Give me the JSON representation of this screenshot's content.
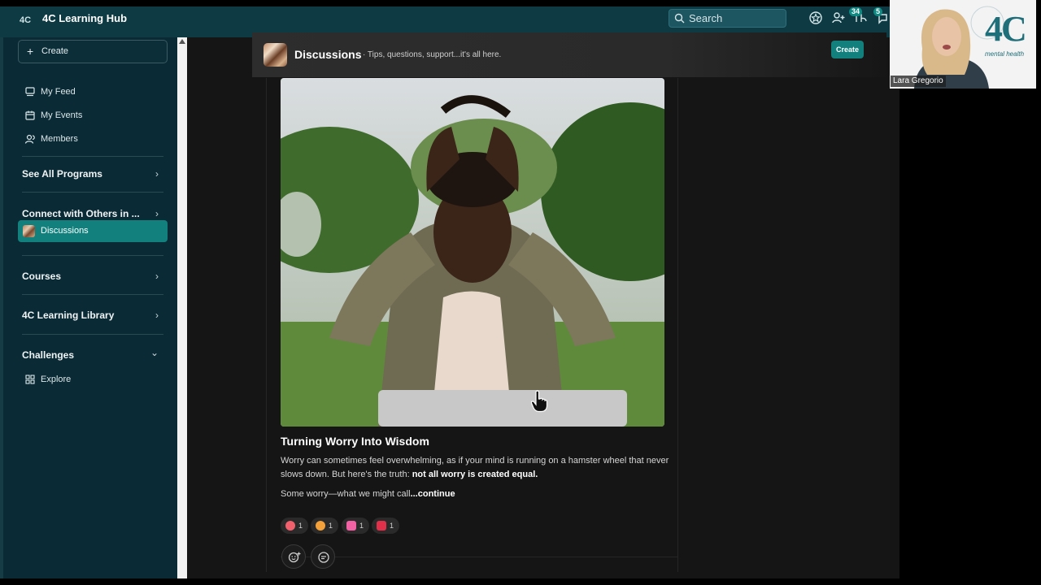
{
  "app": {
    "title": "4C Learning Hub",
    "logo_text": "4C"
  },
  "header": {
    "search_label": "Search",
    "badges": {
      "notifications": "34",
      "messages": "5"
    }
  },
  "sidebar": {
    "create_label": "Create",
    "items": [
      {
        "label": "My Feed",
        "icon": "feed-icon"
      },
      {
        "label": "My Events",
        "icon": "calendar-icon"
      },
      {
        "label": "Members",
        "icon": "members-icon"
      }
    ],
    "sections": [
      {
        "label": "See All Programs",
        "chevron": "›"
      },
      {
        "label": "Connect with Others in ...",
        "chevron": "›"
      },
      {
        "label": "Courses",
        "chevron": "›"
      },
      {
        "label": "4C Learning Library",
        "chevron": "›"
      },
      {
        "label": "Challenges",
        "chevron": "⌄"
      }
    ],
    "active_item": "Discussions",
    "explore_label": "Explore"
  },
  "space": {
    "title": "Discussions",
    "subtitle": "· Tips, questions, support...it's all here.",
    "create_label": "Create"
  },
  "post": {
    "title": "Turning Worry Into Wisdom",
    "body_text": "Worry can sometimes feel overwhelming, as if your mind is running on a hamster wheel that never slows down. But here's the truth: ",
    "body_bold": "not all worry is created equal.",
    "more_text": "Some worry—what we might call",
    "more_link": "...continue",
    "reactions": [
      {
        "icon": "smile-emoji",
        "count": "1",
        "color": "#f0616d"
      },
      {
        "icon": "heart-eyes-emoji",
        "count": "1",
        "color": "#f3a13b"
      },
      {
        "icon": "pink-heart-emoji",
        "count": "1",
        "color": "#f062a4"
      },
      {
        "icon": "red-heart-emoji",
        "count": "1",
        "color": "#e0304a"
      }
    ]
  },
  "video_call": {
    "participant_name": "Lara Gregorio",
    "brand_text": "4C",
    "brand_sub": "mental health"
  },
  "colors": {
    "accent": "#12807d",
    "header": "#0d3a43",
    "sidebar": "#0a2a35"
  }
}
